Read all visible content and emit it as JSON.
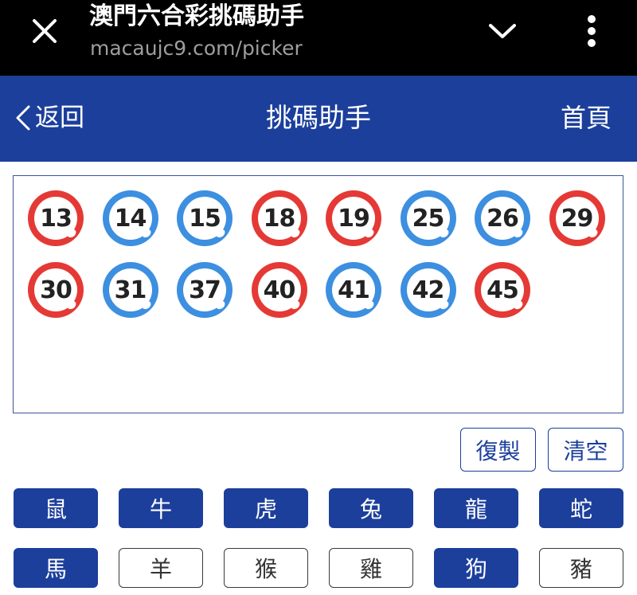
{
  "browser": {
    "page_title": "澳門六合彩挑碼助手",
    "url": "macaujc9.com/picker",
    "close_icon": "close-icon",
    "minimize_icon": "chevron-down-icon",
    "more_icon": "more-vert-icon"
  },
  "navbar": {
    "back_label": "返回",
    "title": "挑碼助手",
    "home_label": "首頁",
    "background": "#1c3f9c"
  },
  "picked_numbers": [
    {
      "num": "13",
      "color": "red"
    },
    {
      "num": "14",
      "color": "blue"
    },
    {
      "num": "15",
      "color": "blue"
    },
    {
      "num": "18",
      "color": "red"
    },
    {
      "num": "19",
      "color": "red"
    },
    {
      "num": "25",
      "color": "blue"
    },
    {
      "num": "26",
      "color": "blue"
    },
    {
      "num": "29",
      "color": "red"
    },
    {
      "num": "30",
      "color": "red"
    },
    {
      "num": "31",
      "color": "blue"
    },
    {
      "num": "37",
      "color": "blue"
    },
    {
      "num": "40",
      "color": "red"
    },
    {
      "num": "41",
      "color": "blue"
    },
    {
      "num": "42",
      "color": "blue"
    },
    {
      "num": "45",
      "color": "red"
    }
  ],
  "ball_colors": {
    "red": "#e53935",
    "blue": "#3d8fe0"
  },
  "actions": {
    "copy_label": "復製",
    "clear_label": "清空"
  },
  "zodiacs": [
    {
      "label": "鼠",
      "selected": true
    },
    {
      "label": "牛",
      "selected": true
    },
    {
      "label": "虎",
      "selected": true
    },
    {
      "label": "兔",
      "selected": true
    },
    {
      "label": "龍",
      "selected": true
    },
    {
      "label": "蛇",
      "selected": true
    },
    {
      "label": "馬",
      "selected": true
    },
    {
      "label": "羊",
      "selected": false
    },
    {
      "label": "猴",
      "selected": false
    },
    {
      "label": "雞",
      "selected": false
    },
    {
      "label": "狗",
      "selected": true
    },
    {
      "label": "豬",
      "selected": false
    }
  ]
}
